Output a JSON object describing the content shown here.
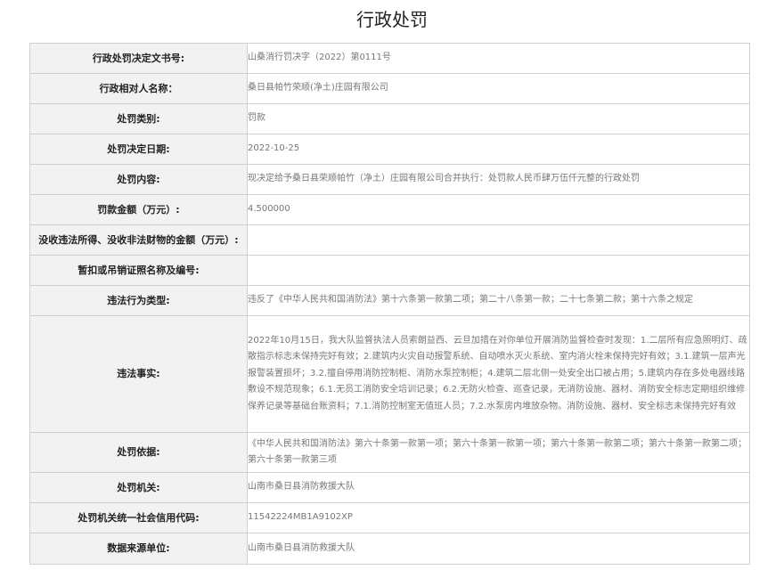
{
  "page": {
    "title": "行政处罚"
  },
  "record": {
    "rows": [
      {
        "label": "行政处罚决定文书号:",
        "value": "山桑消行罚决字（2022）第0111号"
      },
      {
        "label": "行政相对人名称：",
        "value": "桑日县帕竹荣顺(净土)庄园有限公司"
      },
      {
        "label": "处罚类别:",
        "value": "罚款"
      },
      {
        "label": "处罚决定日期:",
        "value": "2022-10-25"
      },
      {
        "label": "处罚内容:",
        "value": "现决定给予桑日县荣顺帕竹（净土）庄园有限公司合并执行：处罚款人民币肆万伍仟元整的行政处罚"
      },
      {
        "label": "罚款金额（万元）:",
        "value": "4.500000"
      },
      {
        "label": "没收违法所得、没收非法财物的金额（万元）:",
        "value": ""
      },
      {
        "label": "暂扣或吊销证照名称及编号:",
        "value": ""
      },
      {
        "label": "违法行为类型:",
        "value": "违反了《中华人民共和国消防法》第十六条第一款第二项；第二十八条第一款；二十七条第二款；第十六条之规定"
      },
      {
        "label": "违法事实:",
        "value": "2022年10月15日，我大队监督执法人员索朗益西、云旦加措在对你单位开展消防监督检查时发现：1.二层所有应急照明灯、疏散指示标志未保持完好有效；2.建筑内火灾自动报警系统、自动喷水灭火系统、室内消火栓未保持完好有效；3.1.建筑一层声光报警装置损坏；3.2.擅自停用消防控制柜、消防水泵控制柜；4.建筑二层北侧一处安全出口被占用；5.建筑内存在多处电器线路敷设不规范现象；6.1.无员工消防安全培训记录；6.2.无防火检查、巡查记录，无消防设施、器材、消防安全标志定期组织维修保养记录等基础台账资料；7.1.消防控制室无值班人员；7.2.水泵房内堆放杂物。消防设施、器材、安全标志未保持完好有效"
      },
      {
        "label": "处罚依据:",
        "value": "《中华人民共和国消防法》第六十条第一款第一项；第六十条第一款第一项；第六十条第一款第二项；第六十条第一款第二项；第六十条第一款第三项"
      },
      {
        "label": "处罚机关:",
        "value": "山南市桑日县消防救援大队"
      },
      {
        "label": "处罚机关统一社会信用代码:",
        "value": "11542224MB1A9102XP"
      },
      {
        "label": "数据来源单位:",
        "value": "山南市桑日县消防救援大队"
      }
    ]
  }
}
